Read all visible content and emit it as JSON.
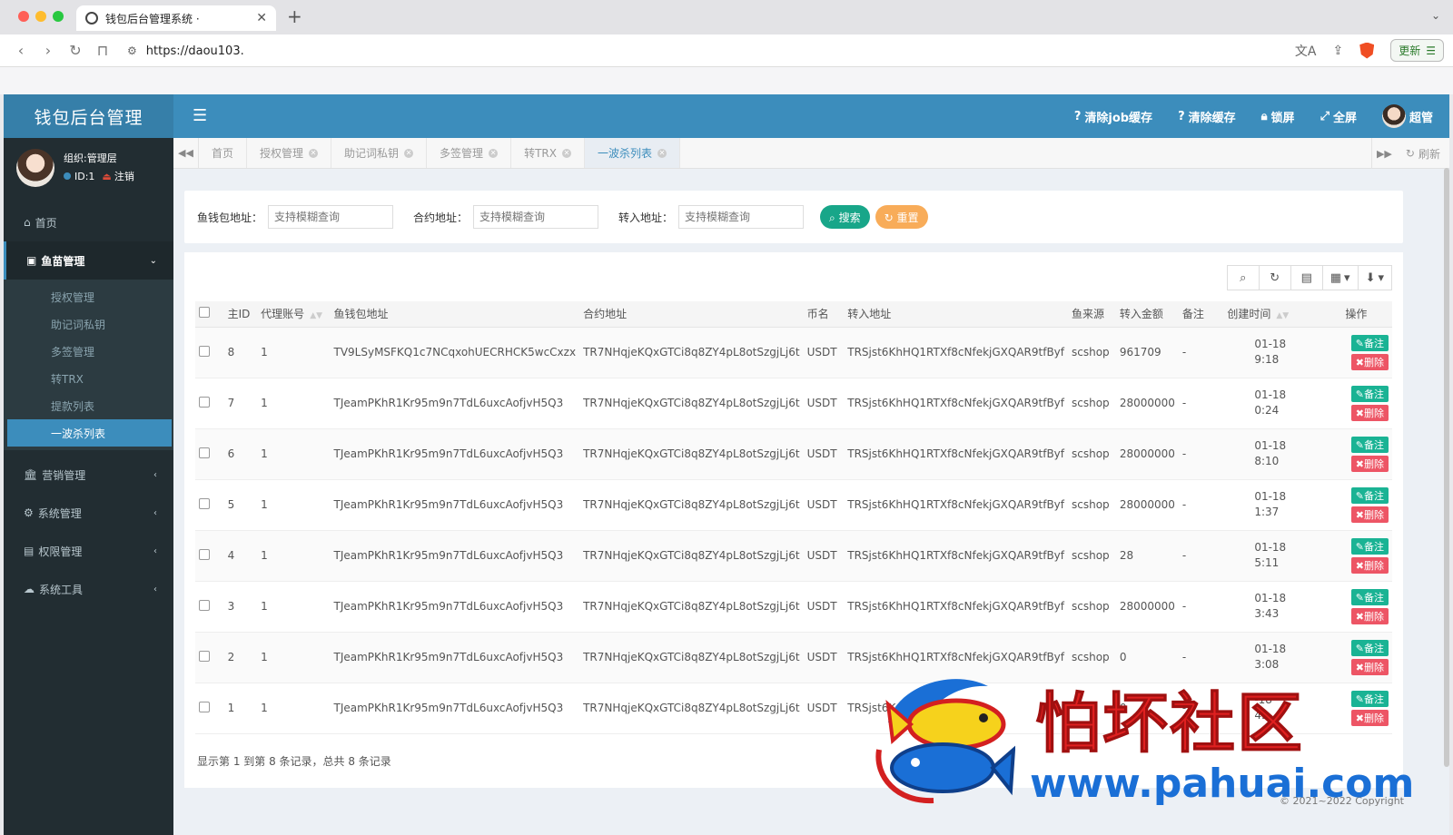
{
  "browser": {
    "tab_title": "钱包后台管理系统 ·",
    "url": "https://daou103.",
    "update_label": "更新"
  },
  "header": {
    "logo": "钱包后台管理",
    "clear_job_cache": "清除job缓存",
    "clear_cache": "清除缓存",
    "lock": "锁屏",
    "fullscreen": "全屏",
    "user": "超管"
  },
  "user_panel": {
    "org": "组织:管理层",
    "id": "ID:1",
    "logout": "注销"
  },
  "sidebar": {
    "home": "首页",
    "fish_mgmt": "鱼苗管理",
    "sub": [
      "授权管理",
      "助记词私钥",
      "多签管理",
      "转TRX",
      "提款列表",
      "一波杀列表"
    ],
    "marketing": "营销管理",
    "system": "系统管理",
    "permission": "权限管理",
    "tools": "系统工具"
  },
  "tabs": [
    "首页",
    "授权管理",
    "助记词私钥",
    "多签管理",
    "转TRX",
    "一波杀列表"
  ],
  "refresh_label": "刷新",
  "search": {
    "fish_wallet_label": "鱼钱包地址：",
    "contract_label": "合约地址：",
    "to_label": "转入地址：",
    "placeholder": "支持模糊查询",
    "search_btn": "搜索",
    "reset_btn": "重置"
  },
  "table": {
    "columns": [
      "主ID",
      "代理账号",
      "鱼钱包地址",
      "合约地址",
      "币名",
      "转入地址",
      "鱼来源",
      "转入金额",
      "备注",
      "创建时间",
      "操作"
    ],
    "rows": [
      {
        "id": "8",
        "agent": "1",
        "fish": "TV9LSyMSFKQ1c7NCqxohUECRHCK5wcCxzx",
        "contract": "TR7NHqjeKQxGTCi8q8ZY4pL8otSzgjLj6t",
        "coin": "USDT",
        "to": "TRSjst6KhHQ1RTXf8cNfekjGXQAR9tfByf",
        "src": "scshop",
        "amount": "961709",
        "note": "-",
        "t1": "01-18",
        "t2": "9:18"
      },
      {
        "id": "7",
        "agent": "1",
        "fish": "TJeamPKhR1Kr95m9n7TdL6uxcAofjvH5Q3",
        "contract": "TR7NHqjeKQxGTCi8q8ZY4pL8otSzgjLj6t",
        "coin": "USDT",
        "to": "TRSjst6KhHQ1RTXf8cNfekjGXQAR9tfByf",
        "src": "scshop",
        "amount": "28000000",
        "note": "-",
        "t1": "01-18",
        "t2": "0:24"
      },
      {
        "id": "6",
        "agent": "1",
        "fish": "TJeamPKhR1Kr95m9n7TdL6uxcAofjvH5Q3",
        "contract": "TR7NHqjeKQxGTCi8q8ZY4pL8otSzgjLj6t",
        "coin": "USDT",
        "to": "TRSjst6KhHQ1RTXf8cNfekjGXQAR9tfByf",
        "src": "scshop",
        "amount": "28000000",
        "note": "-",
        "t1": "01-18",
        "t2": "8:10"
      },
      {
        "id": "5",
        "agent": "1",
        "fish": "TJeamPKhR1Kr95m9n7TdL6uxcAofjvH5Q3",
        "contract": "TR7NHqjeKQxGTCi8q8ZY4pL8otSzgjLj6t",
        "coin": "USDT",
        "to": "TRSjst6KhHQ1RTXf8cNfekjGXQAR9tfByf",
        "src": "scshop",
        "amount": "28000000",
        "note": "-",
        "t1": "01-18",
        "t2": "1:37"
      },
      {
        "id": "4",
        "agent": "1",
        "fish": "TJeamPKhR1Kr95m9n7TdL6uxcAofjvH5Q3",
        "contract": "TR7NHqjeKQxGTCi8q8ZY4pL8otSzgjLj6t",
        "coin": "USDT",
        "to": "TRSjst6KhHQ1RTXf8cNfekjGXQAR9tfByf",
        "src": "scshop",
        "amount": "28",
        "note": "-",
        "t1": "01-18",
        "t2": "5:11"
      },
      {
        "id": "3",
        "agent": "1",
        "fish": "TJeamPKhR1Kr95m9n7TdL6uxcAofjvH5Q3",
        "contract": "TR7NHqjeKQxGTCi8q8ZY4pL8otSzgjLj6t",
        "coin": "USDT",
        "to": "TRSjst6KhHQ1RTXf8cNfekjGXQAR9tfByf",
        "src": "scshop",
        "amount": "28000000",
        "note": "-",
        "t1": "01-18",
        "t2": "3:43"
      },
      {
        "id": "2",
        "agent": "1",
        "fish": "TJeamPKhR1Kr95m9n7TdL6uxcAofjvH5Q3",
        "contract": "TR7NHqjeKQxGTCi8q8ZY4pL8otSzgjLj6t",
        "coin": "USDT",
        "to": "TRSjst6KhHQ1RTXf8cNfekjGXQAR9tfByf",
        "src": "scshop",
        "amount": "0",
        "note": "-",
        "t1": "01-18",
        "t2": "3:08"
      },
      {
        "id": "1",
        "agent": "1",
        "fish": "TJeamPKhR1Kr95m9n7TdL6uxcAofjvH5Q3",
        "contract": "TR7NHqjeKQxGTCi8q8ZY4pL8otSzgjLj6t",
        "coin": "USDT",
        "to": "TRSjst6K",
        "src": "",
        "amount": "0",
        "note": "-",
        "t1": "-18",
        "t2": "43"
      }
    ],
    "note_btn": "备注",
    "delete_btn": "删除",
    "summary": "显示第 1 到第 8 条记录，总共 8 条记录"
  },
  "copyright": "© 2021~2022 Copyright",
  "watermark": {
    "title": "怕坏社区",
    "url": "www.pahuai.com"
  },
  "colors": {
    "header_blue": "#3c8dbc",
    "sidebar_dark": "#222d32",
    "search_green": "#18a689",
    "reset_orange": "#f8ac59",
    "note_green": "#1ab394",
    "delete_red": "#ed5565"
  }
}
